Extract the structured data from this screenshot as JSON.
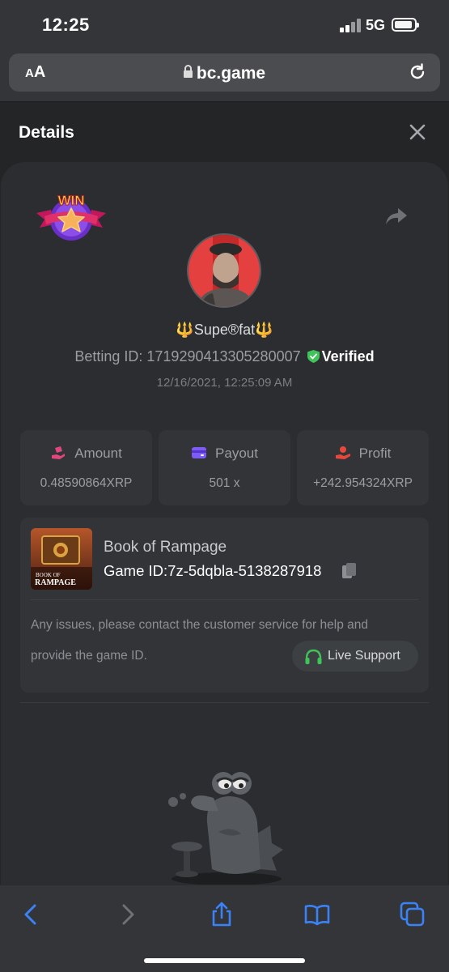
{
  "status_bar": {
    "time": "12:25",
    "network": "5G"
  },
  "browser": {
    "text_size_label": "AA",
    "domain": "bc.game"
  },
  "header": {
    "title": "Details"
  },
  "bet": {
    "username_left_glyph": "🔱",
    "username": "Supe®fat",
    "username_right_glyph": "🔱",
    "betting_id_label": "Betting ID: 171929041330528000​7",
    "verified_label": "Verified",
    "datetime": "12/16/2021, 12:25:09 AM",
    "badge_text": "WIN"
  },
  "stats": [
    {
      "label": "Amount",
      "value": "0.48590864XRP",
      "icon": "money-hand-icon",
      "color": "#e0477a"
    },
    {
      "label": "Payout",
      "value": "501 x",
      "icon": "wallet-card-icon",
      "color": "#7c5cf5"
    },
    {
      "label": "Profit",
      "value": "+242.954324XRP",
      "icon": "profit-hand-icon",
      "color": "#e8473c"
    }
  ],
  "game": {
    "name": "Book of Rampage",
    "game_id": "Game ID:7z-5dqbla-5138287918",
    "thumbnail_title_top": "BOOK OF",
    "thumbnail_title_bottom": "RAMPAGE",
    "issue_line1": "Any issues, please contact the customer service for help and",
    "issue_line2": "provide the game ID.",
    "support_label": "Live Support"
  },
  "colors": {
    "accent_green": "#3fc35a",
    "toolbar_blue": "#3b82f6",
    "card_bg": "#323438"
  }
}
